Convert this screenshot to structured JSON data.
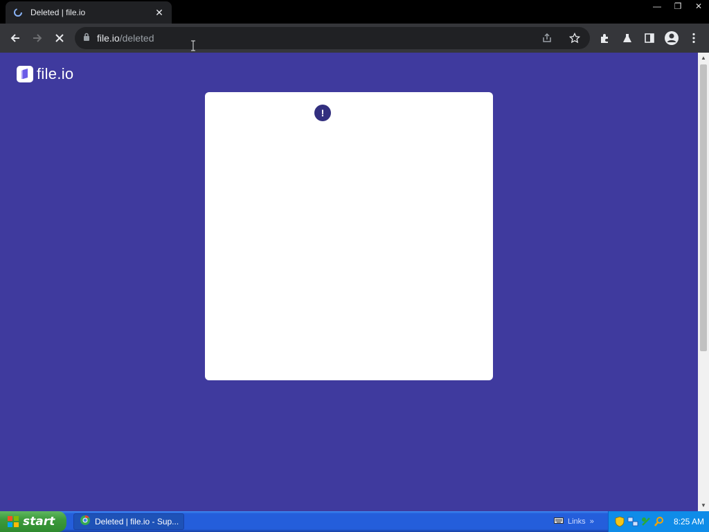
{
  "browser": {
    "tab": {
      "title": "Deleted | file.io",
      "close_glyph": "✕"
    },
    "window_controls": {
      "minimize": "—",
      "restore": "❐",
      "close": "✕"
    },
    "address": {
      "host": "file.io",
      "path": "/deleted"
    },
    "icons": [
      "back-icon",
      "forward-icon",
      "stop-icon",
      "lock-icon",
      "share-icon",
      "star-icon",
      "extensions-icon",
      "labs-icon",
      "side-panel-icon",
      "profile-icon",
      "menu-icon"
    ]
  },
  "page": {
    "logo_text": "file.io",
    "alert_glyph": "!",
    "colors": {
      "background": "#3f3a9e",
      "card": "#ffffff",
      "alert": "#322f7f"
    }
  },
  "taskbar": {
    "start_label": "start",
    "task_label": "Deleted | file.io - Sup...",
    "links_label": "Links",
    "links_chevron": "»",
    "clock": "8:25 AM"
  }
}
